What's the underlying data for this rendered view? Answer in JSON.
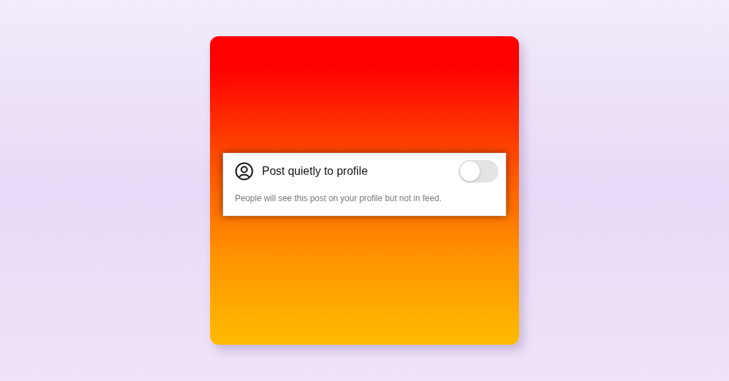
{
  "setting": {
    "label": "Post quietly to profile",
    "on": false,
    "description": "People will see this post on your profile but not in feed."
  }
}
